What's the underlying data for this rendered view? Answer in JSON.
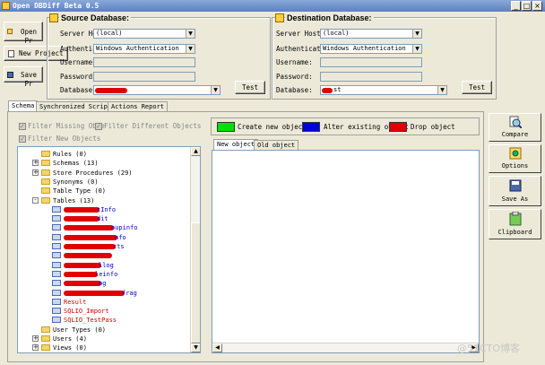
{
  "window": {
    "title": "Open DBDiff Beta 0.5",
    "min": "_",
    "max": "□",
    "close": "×"
  },
  "toolbar": {
    "open": "Open Pr",
    "new": "New Project",
    "save": "Save Pr"
  },
  "source": {
    "title": "Source Database:",
    "server_label": "Server Host:",
    "server_value": "(local)",
    "auth_label": "Authenticatio",
    "auth_value": "Windows Authentication",
    "user_label": "Username:",
    "pass_label": "Password:",
    "db_label": "Database:",
    "test": "Test"
  },
  "dest": {
    "title": "Destination Database:",
    "server_label": "Server Host:",
    "server_value": "(local)",
    "auth_label": "Authenticatio",
    "auth_value": "Windows Authentication",
    "user_label": "Username:",
    "pass_label": "Password:",
    "db_label": "Database:",
    "db_value": "st",
    "test": "Test"
  },
  "tabs": [
    "Schema",
    "Synchronized Script",
    "Actions Report"
  ],
  "filters": {
    "missing": "Filter Missing Obje",
    "different": "Filter Different Objects",
    "new": "Filter New Objects"
  },
  "tree": [
    {
      "label": "Rules (0)",
      "type": "folder",
      "exp": false
    },
    {
      "label": "Schemas (13)",
      "type": "folder",
      "exp": "+"
    },
    {
      "label": "Store Procedures (29)",
      "type": "folder",
      "exp": "+"
    },
    {
      "label": "Synonyms (0)",
      "type": "folder",
      "exp": false
    },
    {
      "label": "Table Type (0)",
      "type": "folder",
      "exp": false
    },
    {
      "label": "Tables (13)",
      "type": "folder",
      "exp": "-"
    },
    {
      "label": "tInfo",
      "type": "table",
      "color": "#0000cc",
      "redact": 40
    },
    {
      "label": "dit",
      "type": "table",
      "color": "#0000cc",
      "redact": 40
    },
    {
      "label": "oupinfo",
      "type": "table",
      "color": "#0000cc",
      "redact": 56
    },
    {
      "label": "nfo",
      "type": "table",
      "color": "#0000cc",
      "redact": 60
    },
    {
      "label": "cts",
      "type": "table",
      "color": "#0000cc",
      "redact": 58
    },
    {
      "label": "",
      "type": "table",
      "color": "#0000cc",
      "redact": 54
    },
    {
      "label": "llog",
      "type": "table",
      "color": "#0000cc",
      "redact": 42
    },
    {
      "label": "leinfo",
      "type": "table",
      "color": "#0000cc",
      "redact": 38
    },
    {
      "label": "og",
      "type": "table",
      "color": "#0000cc",
      "redact": 42
    },
    {
      "label": "frag",
      "type": "table",
      "color": "#0000cc",
      "redact": 68
    },
    {
      "label": "Result",
      "type": "table",
      "color": "#cc0000",
      "redact": 0
    },
    {
      "label": "SQLIO_Import",
      "type": "table",
      "color": "#cc0000",
      "redact": 0
    },
    {
      "label": "SQLIO_TestPass",
      "type": "table",
      "color": "#cc0000",
      "redact": 0
    },
    {
      "label": "User Types (0)",
      "type": "folder",
      "exp": false
    },
    {
      "label": "Users (4)",
      "type": "folder",
      "exp": "+"
    },
    {
      "label": "Views (0)",
      "type": "folder",
      "exp": "+"
    }
  ],
  "legend": {
    "create": "Create new object",
    "alter": "Alter existing object",
    "drop": "Drop object"
  },
  "colors": {
    "create": "#00e000",
    "alter": "#0000e0",
    "drop": "#e00000"
  },
  "subtabs": [
    "New object",
    "Old object"
  ],
  "side": {
    "compare": "Compare",
    "options": "Options",
    "saveas": "Save As",
    "clipboard": "Clipboard"
  },
  "watermark": "@51CTO博客"
}
